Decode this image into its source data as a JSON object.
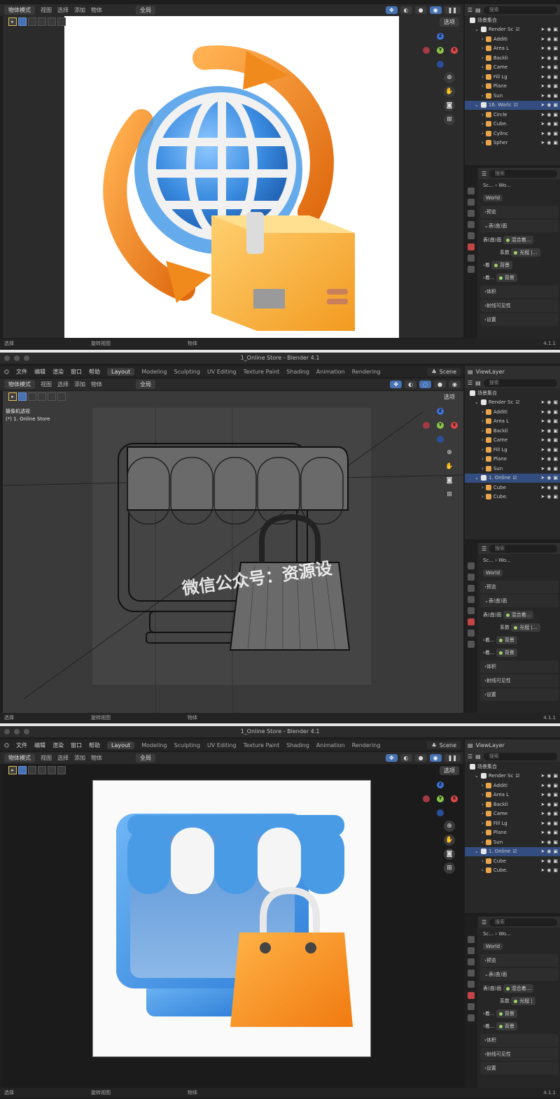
{
  "panels": [
    {
      "title": "",
      "topmenu": {
        "items": [],
        "scene": "",
        "viewlayer": ""
      },
      "toolbar": {
        "mode": "物体模式",
        "menus": [
          "视图",
          "选择",
          "添加",
          "物体"
        ],
        "transform": "全局",
        "options": "选项"
      },
      "viewport_overlay": {
        "text1": "",
        "text2": ""
      },
      "statusbar": {
        "select": "选择",
        "rotate": "旋转视图",
        "object": "物体",
        "version": "4.1.1"
      },
      "outliner": {
        "search": "搜索",
        "rows": [
          {
            "name": "场景集合",
            "indent": 0,
            "icon": "collection"
          },
          {
            "name": "Render Sc",
            "indent": 1,
            "icon": "collection",
            "check": "☑"
          },
          {
            "name": "Additi",
            "indent": 2,
            "icon": "light"
          },
          {
            "name": "Area L",
            "indent": 2,
            "icon": "light"
          },
          {
            "name": "Backli",
            "indent": 2,
            "icon": "light"
          },
          {
            "name": "Came",
            "indent": 2,
            "icon": "camera"
          },
          {
            "name": "Fill Lg",
            "indent": 2,
            "icon": "light"
          },
          {
            "name": "Plane",
            "indent": 2,
            "icon": "mesh"
          },
          {
            "name": "Sun",
            "indent": 2,
            "icon": "light"
          },
          {
            "name": "16. Worlc",
            "indent": 1,
            "icon": "collection",
            "check": "☑",
            "highlight": true
          },
          {
            "name": "Circle",
            "indent": 2,
            "icon": "mesh"
          },
          {
            "name": "Cube.",
            "indent": 2,
            "icon": "mesh"
          },
          {
            "name": "Cylinc",
            "indent": 2,
            "icon": "mesh"
          },
          {
            "name": "Spher",
            "indent": 2,
            "icon": "mesh"
          }
        ]
      },
      "props": {
        "search": "搜索",
        "breadcrumb": [
          "Sc...",
          "Wo..."
        ],
        "world": "World",
        "sections": {
          "preview": "预览",
          "surface": "表(曲)面",
          "surface_label": "表(曲)面",
          "surface_value": "混合着...",
          "factor_label": "系数",
          "factor_value": "光程 |...",
          "shader1": "着",
          "bg1": "背景",
          "shader2": "着...",
          "bg2": "背景",
          "volume": "体积",
          "ray_vis": "射线可见性",
          "settings": "设置"
        }
      }
    },
    {
      "title": "1_Online Store - Blender 4.1",
      "topmenu": {
        "items": [
          "文件",
          "编辑",
          "渲染",
          "窗口",
          "帮助"
        ],
        "workspaces": [
          "Layout",
          "Modeling",
          "Sculpting",
          "UV Editing",
          "Texture Paint",
          "Shading",
          "Animation",
          "Rendering"
        ],
        "scene": "Scene",
        "viewlayer": "ViewLayer"
      },
      "toolbar": {
        "mode": "物体模式",
        "menus": [
          "视图",
          "选择",
          "添加",
          "物体"
        ],
        "transform": "全局",
        "options": "选项"
      },
      "viewport_overlay": {
        "text1": "摄像机透视",
        "text2": "(*) 1. Online Store"
      },
      "watermark": "微信公众号：资源设",
      "statusbar": {
        "select": "选择",
        "rotate": "旋转视图",
        "object": "物体",
        "version": "4.1.1"
      },
      "outliner": {
        "search": "搜索",
        "rows": [
          {
            "name": "场景集合",
            "indent": 0,
            "icon": "collection"
          },
          {
            "name": "Render Sc",
            "indent": 1,
            "icon": "collection",
            "check": "☑"
          },
          {
            "name": "Additi",
            "indent": 2,
            "icon": "light"
          },
          {
            "name": "Area L",
            "indent": 2,
            "icon": "light"
          },
          {
            "name": "Backli",
            "indent": 2,
            "icon": "light"
          },
          {
            "name": "Came",
            "indent": 2,
            "icon": "camera"
          },
          {
            "name": "Fill Lg",
            "indent": 2,
            "icon": "light"
          },
          {
            "name": "Plane",
            "indent": 2,
            "icon": "mesh"
          },
          {
            "name": "Sun",
            "indent": 2,
            "icon": "light"
          },
          {
            "name": "1. Online",
            "indent": 1,
            "icon": "collection",
            "check": "☑",
            "highlight": true
          },
          {
            "name": "Cube",
            "indent": 2,
            "icon": "mesh"
          },
          {
            "name": "Cube.",
            "indent": 2,
            "icon": "mesh"
          }
        ]
      },
      "props": {
        "search": "搜索",
        "breadcrumb": [
          "Sc...",
          "Wo..."
        ],
        "world": "World",
        "sections": {
          "preview": "预览",
          "surface": "表(曲)面",
          "surface_label": "表(曲)面",
          "surface_value": "混合着...",
          "factor_label": "系数",
          "factor_value": "光程 |...",
          "shader1": "着...",
          "bg1": "背景",
          "shader2": "着...",
          "bg2": "背景",
          "volume": "体积",
          "ray_vis": "射线可见性",
          "settings": "设置"
        }
      }
    },
    {
      "title": "1_Online Store - Blender 4.1",
      "topmenu": {
        "items": [
          "文件",
          "编辑",
          "渲染",
          "窗口",
          "帮助"
        ],
        "workspaces": [
          "Layout",
          "Modeling",
          "Sculpting",
          "UV Editing",
          "Texture Paint",
          "Shading",
          "Animation",
          "Rendering"
        ],
        "scene": "Scene",
        "viewlayer": "ViewLayer"
      },
      "toolbar": {
        "mode": "物体模式",
        "menus": [
          "视图",
          "选择",
          "添加",
          "物体"
        ],
        "transform": "全局",
        "options": "选项"
      },
      "viewport_overlay": {
        "text1": "",
        "text2": ""
      },
      "statusbar": {
        "select": "选择",
        "rotate": "旋转视图",
        "object": "物体",
        "version": "4.1.1"
      },
      "outliner": {
        "search": "搜索",
        "rows": [
          {
            "name": "场景集合",
            "indent": 0,
            "icon": "collection"
          },
          {
            "name": "Render Sc",
            "indent": 1,
            "icon": "collection",
            "check": "☑"
          },
          {
            "name": "Additi",
            "indent": 2,
            "icon": "light"
          },
          {
            "name": "Area L",
            "indent": 2,
            "icon": "light"
          },
          {
            "name": "Backli",
            "indent": 2,
            "icon": "light"
          },
          {
            "name": "Came",
            "indent": 2,
            "icon": "camera"
          },
          {
            "name": "Fill Lg",
            "indent": 2,
            "icon": "light"
          },
          {
            "name": "Plane",
            "indent": 2,
            "icon": "mesh"
          },
          {
            "name": "Sun",
            "indent": 2,
            "icon": "light"
          },
          {
            "name": "1. Online",
            "indent": 1,
            "icon": "collection",
            "check": "☑",
            "highlight": true
          },
          {
            "name": "Cube",
            "indent": 2,
            "icon": "mesh"
          },
          {
            "name": "Cube.",
            "indent": 2,
            "icon": "mesh"
          }
        ]
      },
      "props": {
        "search": "搜索",
        "breadcrumb": [
          "Sc...",
          "Wo..."
        ],
        "world": "World",
        "sections": {
          "preview": "预览",
          "surface": "表(曲)面",
          "surface_label": "表(曲)面",
          "surface_value": "混合着...",
          "factor_label": "系数",
          "factor_value": "光程 |",
          "shader1": "着...",
          "bg1": "背景",
          "shader2": "着...",
          "bg2": "背景",
          "volume": "体积",
          "ray_vis": "射线可见性",
          "settings": "设置"
        }
      }
    }
  ],
  "colors": {
    "accent": "#4772b3",
    "orange": "#f08a1c",
    "blue": "#4a9be6",
    "cardboard": "#f7b845"
  },
  "axes": {
    "x": "X",
    "y": "Y",
    "z": "Z"
  }
}
